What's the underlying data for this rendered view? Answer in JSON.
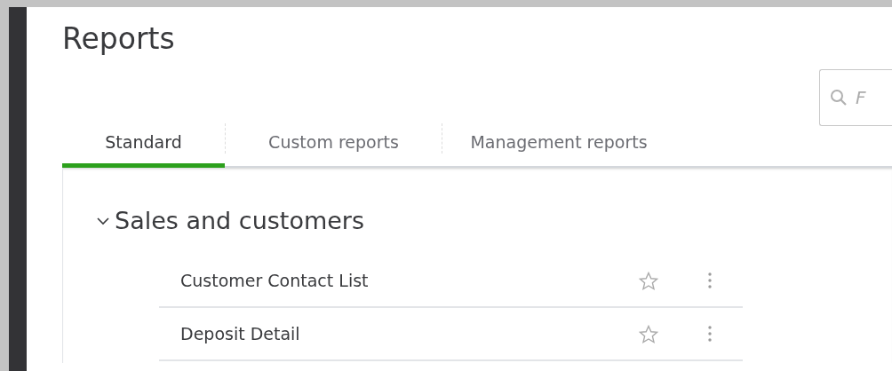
{
  "page_title": "Reports",
  "search": {
    "placeholder": "F"
  },
  "tabs": [
    {
      "label": "Standard",
      "selected": true
    },
    {
      "label": "Custom reports",
      "selected": false
    },
    {
      "label": "Management reports",
      "selected": false
    }
  ],
  "sections": [
    {
      "title": "Sales and customers",
      "expanded": true,
      "reports": [
        {
          "name": "Customer Contact List",
          "favorite": false
        },
        {
          "name": "Deposit Detail",
          "favorite": false
        }
      ]
    }
  ]
}
